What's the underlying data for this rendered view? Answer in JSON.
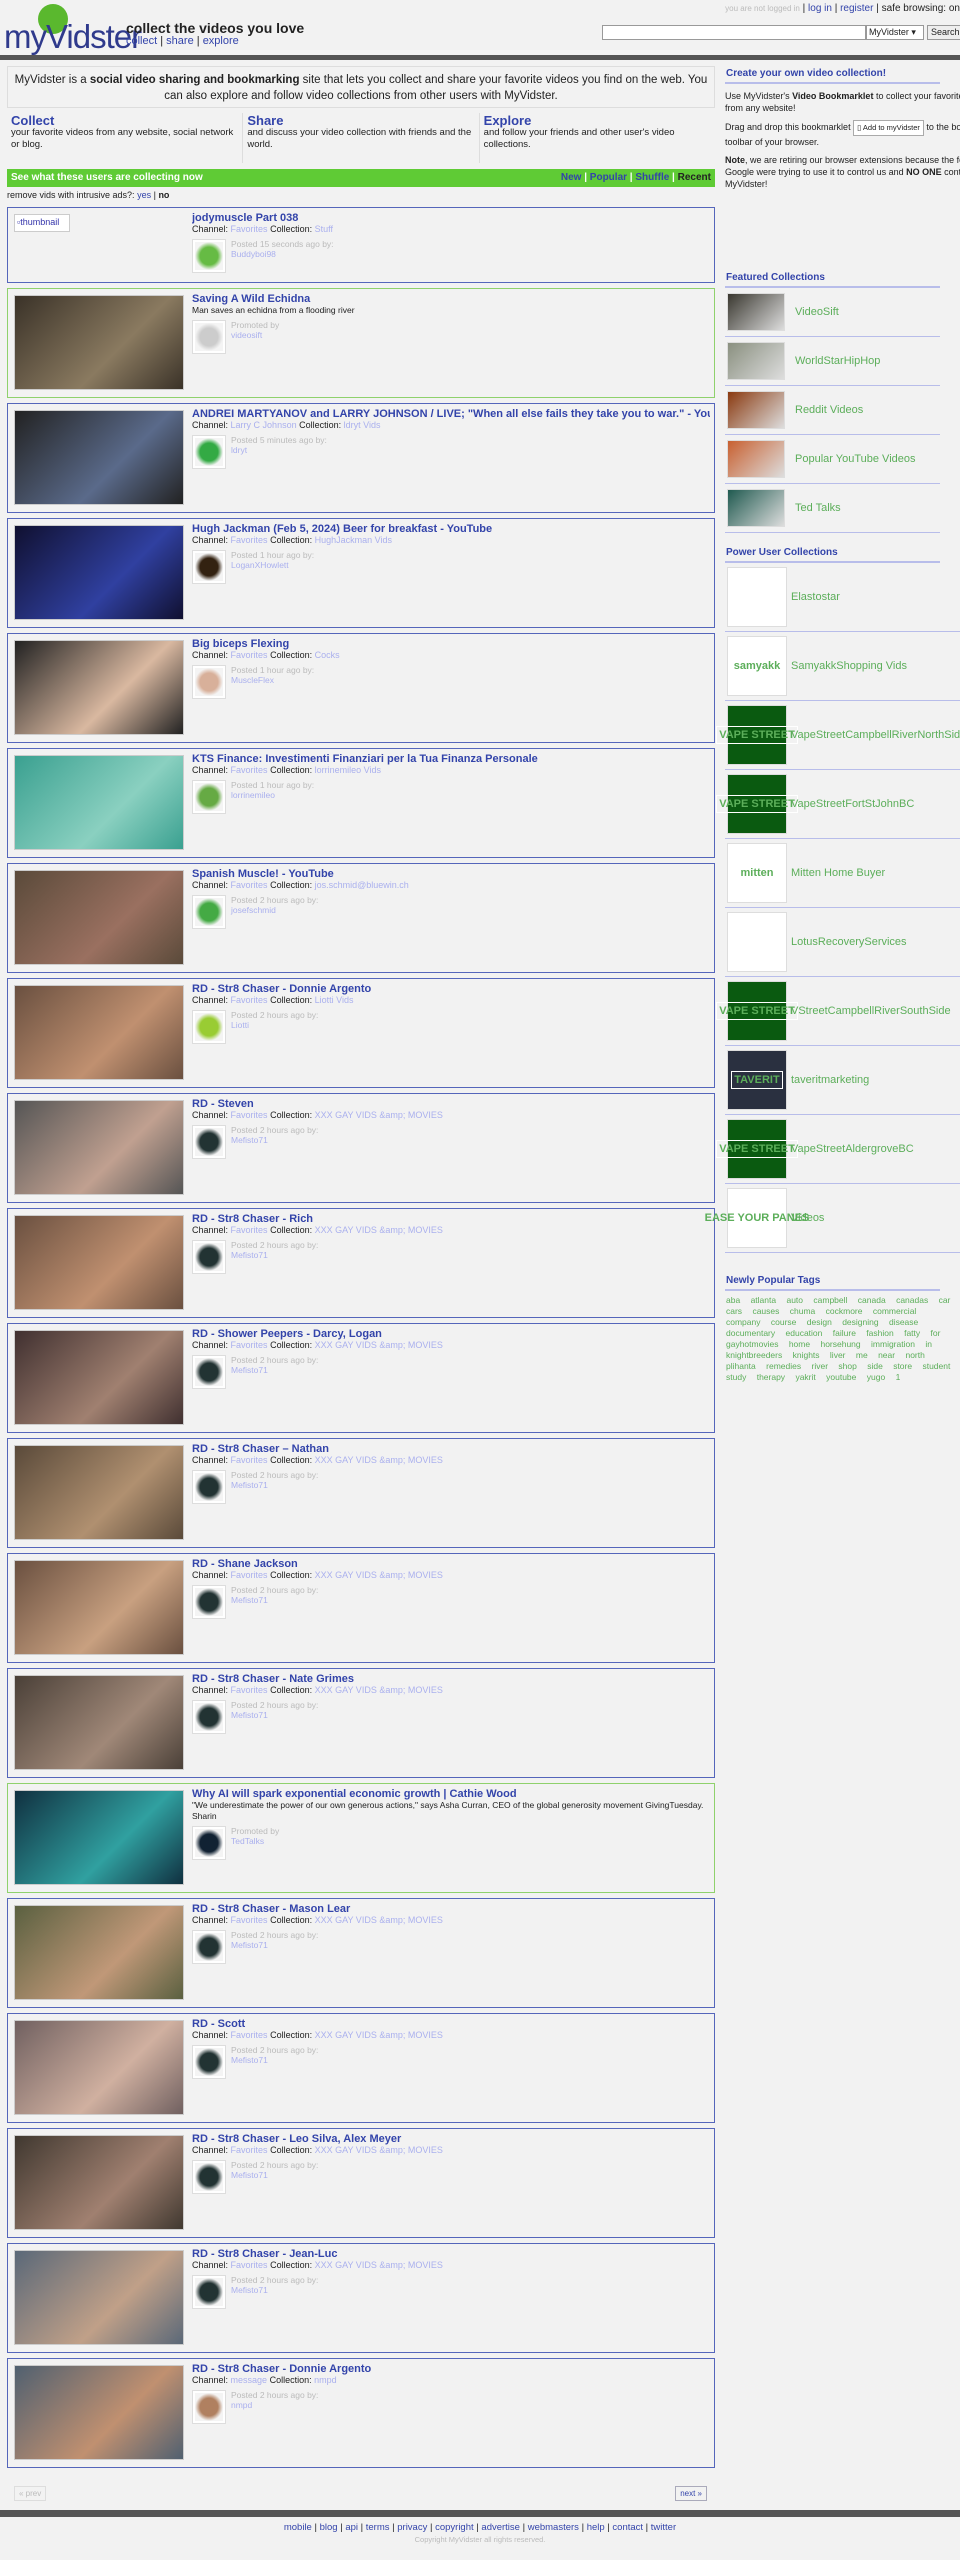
{
  "header": {
    "logo": "myVidster",
    "tagline": "collect the videos you love",
    "nav": [
      "collect",
      "share",
      "explore"
    ],
    "status": "you are not logged in",
    "login": "log in",
    "register": "register",
    "safe": "safe browsing: on",
    "search_value": "",
    "search_scope": "MyVidster",
    "search_button": "Search"
  },
  "intro": {
    "pre": "MyVidster is a ",
    "bold": "social video sharing and bookmarking",
    "post": " site that lets you collect and share your favorite videos you find on the web. You can also explore and follow video collections from other users with MyVidster."
  },
  "columns": [
    {
      "title": "Collect",
      "text": "your favorite videos from any website, social network or blog."
    },
    {
      "title": "Share",
      "text": "and discuss your video collection with friends and the world."
    },
    {
      "title": "Explore",
      "text": "and follow your friends and other user's video collections."
    }
  ],
  "feed_bar": {
    "label": "See what these users are collecting now",
    "sorts": [
      "New",
      "Popular",
      "Shuffle"
    ],
    "active": "Recent"
  },
  "remove_ads": {
    "label": "remove vids with intrusive ads?:",
    "yes": "yes",
    "no": "no"
  },
  "labels": {
    "channel": "Channel:",
    "collection": "Collection:",
    "promoted": "Promoted by"
  },
  "items": [
    {
      "title": "jodymuscle Part 038",
      "channel": "Favorites",
      "collection": "Stuff",
      "posted": "Posted 15 seconds ago by:",
      "user": "Buddyboi98",
      "thumb": "thumbnail",
      "colors": [
        "#fff",
        "#fff"
      ],
      "avatar": "#6b4"
    },
    {
      "title": "Saving A Wild Echidna",
      "promo": true,
      "desc": "Man saves an echidna from a flooding river",
      "user": "videosift",
      "colors": [
        "#3a3228",
        "#8a7a60"
      ],
      "avatar": "#ccc"
    },
    {
      "title": "ANDREI MARTYANOV and LARRY JOHNSON / LIVE; \"When all else fails they take you to war.\" - YouTube",
      "channel": "Larry C Johnson",
      "collection": "ldryt Vids",
      "posted": "Posted 5 minutes ago by:",
      "user": "ldryt",
      "colors": [
        "#222",
        "#5a6a8a"
      ],
      "avatar": "#3a4"
    },
    {
      "title": "Hugh Jackman (Feb 5, 2024) Beer for breakfast - YouTube",
      "channel": "Favorites",
      "collection": "HughJackman Vids",
      "posted": "Posted 1 hour ago by:",
      "user": "LoganXHowlett",
      "colors": [
        "#101030",
        "#3040a0"
      ],
      "avatar": "#321"
    },
    {
      "title": "Big biceps Flexing",
      "channel": "Favorites",
      "collection": "Cocks",
      "posted": "Posted 1 hour ago by:",
      "user": "MuscleFlex",
      "colors": [
        "#222",
        "#d9b8a0"
      ],
      "avatar": "#d8b09a"
    },
    {
      "title": "KTS Finance: Investimenti Finanziari per la Tua Finanza Personale",
      "channel": "Favorites",
      "collection": "lorrinemileo Vids",
      "posted": "Posted 1 hour ago by:",
      "user": "lorrinemileo",
      "colors": [
        "#3aa090",
        "#8ad0c0"
      ],
      "avatar": "#6a4"
    },
    {
      "title": "Spanish Muscle! - YouTube",
      "channel": "Favorites",
      "collection": "jos.schmid@bluewin.ch",
      "posted": "Posted 2 hours ago by:",
      "user": "josefschmid",
      "colors": [
        "#5a4a3a",
        "#9a7060"
      ],
      "avatar": "#4a4"
    },
    {
      "title": "RD - Str8 Chaser - Donnie Argento",
      "channel": "Favorites",
      "collection": "Liotti Vids",
      "posted": "Posted 2 hours ago by:",
      "user": "Liotti",
      "colors": [
        "#6a5040",
        "#c09070"
      ],
      "avatar": "#9c3"
    },
    {
      "title": "RD - Steven",
      "channel": "Favorites",
      "collection": "XXX GAY VIDS &amp; MOVIES",
      "posted": "Posted 2 hours ago by:",
      "user": "Mefisto71",
      "colors": [
        "#555",
        "#c0a090"
      ],
      "avatar": "#233"
    },
    {
      "title": "RD - Str8 Chaser - Rich",
      "channel": "Favorites",
      "collection": "XXX GAY VIDS &amp; MOVIES",
      "posted": "Posted 2 hours ago by:",
      "user": "Mefisto71",
      "colors": [
        "#6a5040",
        "#c09070"
      ],
      "avatar": "#233"
    },
    {
      "title": "RD - Shower Peepers - Darcy, Logan",
      "channel": "Favorites",
      "collection": "XXX GAY VIDS &amp; MOVIES",
      "posted": "Posted 2 hours ago by:",
      "user": "Mefisto71",
      "colors": [
        "#403030",
        "#a08070"
      ],
      "avatar": "#233"
    },
    {
      "title": "RD - Str8 Chaser – Nathan",
      "channel": "Favorites",
      "collection": "XXX GAY VIDS &amp; MOVIES",
      "posted": "Posted 2 hours ago by:",
      "user": "Mefisto71",
      "colors": [
        "#5a4a3a",
        "#b09070"
      ],
      "avatar": "#233"
    },
    {
      "title": "RD - Shane Jackson",
      "channel": "Favorites",
      "collection": "XXX GAY VIDS &amp; MOVIES",
      "posted": "Posted 2 hours ago by:",
      "user": "Mefisto71",
      "colors": [
        "#6a5040",
        "#c8a080"
      ],
      "avatar": "#233"
    },
    {
      "title": "RD - Str8 Chaser - Nate Grimes",
      "channel": "Favorites",
      "collection": "XXX GAY VIDS &amp; MOVIES",
      "posted": "Posted 2 hours ago by:",
      "user": "Mefisto71",
      "colors": [
        "#4a4038",
        "#a08878"
      ],
      "avatar": "#233"
    },
    {
      "title": "Why AI will spark exponential economic growth | Cathie Wood",
      "promo": true,
      "desc": "\"We underestimate the power of our own generous actions,\" says Asha Curran, CEO of the global generosity movement GivingTuesday. Sharin",
      "user": "TedTalks",
      "colors": [
        "#103040",
        "#30a0a0"
      ],
      "avatar": "#123"
    },
    {
      "title": "RD - Str8 Chaser - Mason Lear",
      "channel": "Favorites",
      "collection": "XXX GAY VIDS &amp; MOVIES",
      "posted": "Posted 2 hours ago by:",
      "user": "Mefisto71",
      "colors": [
        "#5a6040",
        "#c09878"
      ],
      "avatar": "#233"
    },
    {
      "title": "RD - Scott",
      "channel": "Favorites",
      "collection": "XXX GAY VIDS &amp; MOVIES",
      "posted": "Posted 2 hours ago by:",
      "user": "Mefisto71",
      "colors": [
        "#706060",
        "#d0b0a0"
      ],
      "avatar": "#233"
    },
    {
      "title": "RD - Str8 Chaser - Leo Silva, Alex Meyer",
      "channel": "Favorites",
      "collection": "XXX GAY VIDS &amp; MOVIES",
      "posted": "Posted 2 hours ago by:",
      "user": "Mefisto71",
      "colors": [
        "#403830",
        "#a08070"
      ],
      "avatar": "#233"
    },
    {
      "title": "RD - Str8 Chaser - Jean-Luc",
      "channel": "Favorites",
      "collection": "XXX GAY VIDS &amp; MOVIES",
      "posted": "Posted 2 hours ago by:",
      "user": "Mefisto71",
      "colors": [
        "#5a6878",
        "#c0a088"
      ],
      "avatar": "#233"
    },
    {
      "title": "RD - Str8 Chaser - Donnie Argento",
      "channel": "message",
      "collection": "nmpd",
      "posted": "Posted 2 hours ago by:",
      "user": "nmpd",
      "colors": [
        "#506070",
        "#c09070"
      ],
      "avatar": "#b08060"
    }
  ],
  "pager": {
    "prev": "« prev",
    "next": "next »"
  },
  "sidebar": {
    "create_title": "Create your own video collection!",
    "p1_pre": "Use MyVidster's ",
    "p1_bold": "Video Bookmarklet",
    "p1_post": " to collect your favorite videos from any website!",
    "p2_pre": "Drag and drop this bookmarklet ",
    "bookmarklet": "Add to myVidster",
    "p2_post": " to the bookmark toolbar of your browser.",
    "p3_bold": "Note",
    "p3_mid": ", we are retiring our browser extensions because the folks at Google were trying to use it to control us and ",
    "p3_bold2": "NO ONE",
    "p3_post": " controls MyVidster!",
    "featured_title": "Featured Collections",
    "featured": [
      {
        "name": "VideoSift",
        "color": "#3a3830"
      },
      {
        "name": "WorldStarHipHop",
        "color": "#8a9080"
      },
      {
        "name": "Reddit Videos",
        "color": "#8a3a10"
      },
      {
        "name": "Popular YouTube Videos",
        "color": "#c86030"
      },
      {
        "name": "Ted Talks",
        "color": "#205a50"
      }
    ],
    "power_title": "Power User Collections",
    "power": [
      {
        "name": "Elastostar",
        "color": "#fff",
        "logo": ""
      },
      {
        "name": "SamyakkShopping Vids",
        "color": "#fff",
        "logo": "samyakk"
      },
      {
        "name": "VapeStreetCampbellRiverNorthSide",
        "color": "#0a5a10",
        "logo": "VAPE STREET"
      },
      {
        "name": "VapeStreetFortStJohnBC",
        "color": "#0a5a10",
        "logo": "VAPE STREET"
      },
      {
        "name": "Mitten Home Buyer",
        "color": "#fff",
        "logo": "mitten"
      },
      {
        "name": "LotusRecoveryServices",
        "color": "#fff",
        "logo": ""
      },
      {
        "name": "VStreetCampbellRiverSouthSide",
        "color": "#0a5a10",
        "logo": "VAPE STREET"
      },
      {
        "name": "taveritmarketing",
        "color": "#2a3040",
        "logo": "TAVERIT"
      },
      {
        "name": "VapeStreetAldergroveBC",
        "color": "#0a5a10",
        "logo": "VAPE STREET"
      },
      {
        "name": "Videos",
        "color": "#fff",
        "logo": "EASE YOUR PANES"
      }
    ],
    "tags_title": "Newly Popular Tags",
    "tags": [
      "aba",
      "atlanta",
      "auto",
      "campbell",
      "canada",
      "canadas",
      "car",
      "cars",
      "causes",
      "chuma",
      "cockmore",
      "commercial",
      "company",
      "course",
      "design",
      "designing",
      "disease",
      "documentary",
      "education",
      "failure",
      "fashion",
      "fatty",
      "for",
      "gayhotmovies",
      "home",
      "horsehung",
      "immigration",
      "in",
      "knightbreeders",
      "knights",
      "liver",
      "me",
      "near",
      "north",
      "plihanta",
      "remedies",
      "river",
      "shop",
      "side",
      "store",
      "student",
      "study",
      "therapy",
      "yakrit",
      "youtube",
      "yugo",
      "1"
    ]
  },
  "footer": {
    "links": [
      "mobile",
      "blog",
      "api",
      "terms",
      "privacy",
      "copyright",
      "advertise",
      "webmasters",
      "help",
      "contact",
      "twitter"
    ],
    "copyright": "Copyright MyVidster all rights reserved."
  },
  "colors": {
    "brand_blue": "#3344aa",
    "green_bar": "#5fcb35",
    "promo_border": "#8fd16c",
    "item_border": "#5566bb",
    "dark_bar": "#555555"
  }
}
